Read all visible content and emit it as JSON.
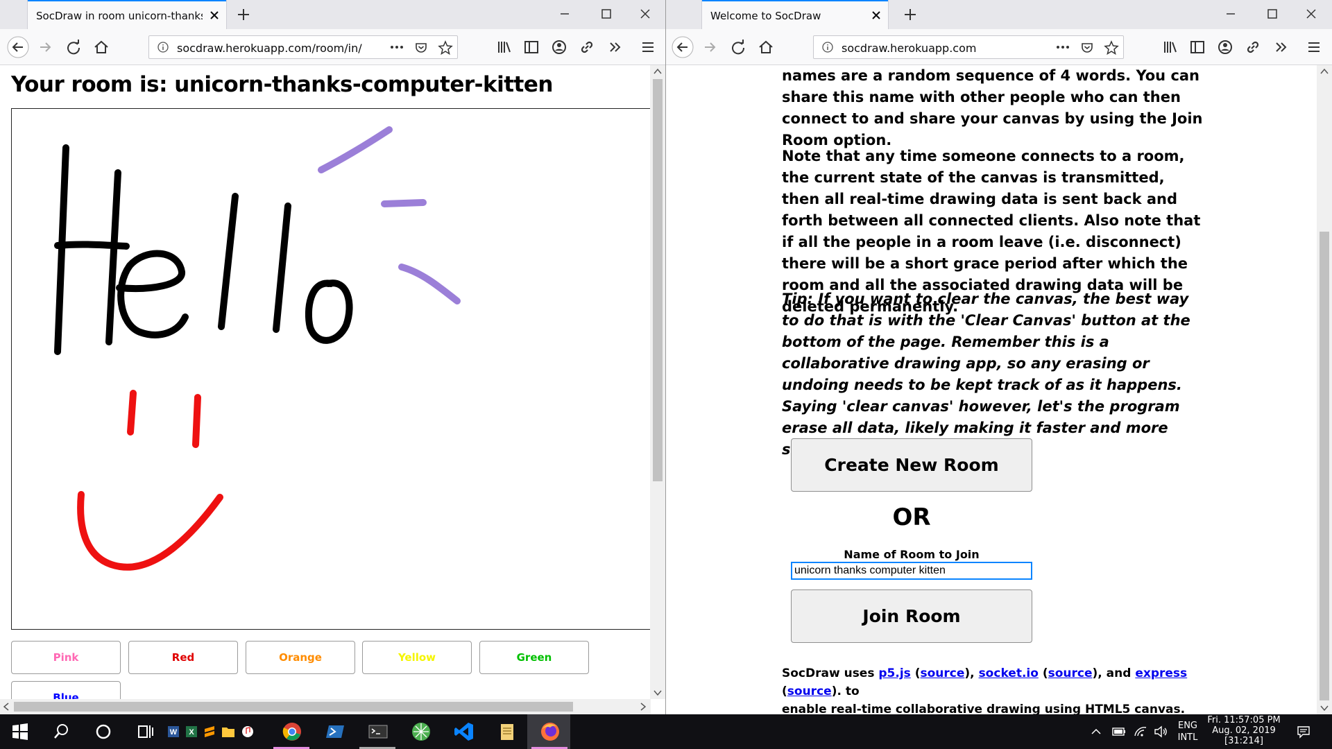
{
  "left_window": {
    "tab_title": "SocDraw in room unicorn-thanks-c",
    "url": "socdraw.herokuapp.com/room/in/",
    "heading": "Your room is: unicorn-thanks-computer-kitten",
    "color_buttons": [
      {
        "label": "Pink",
        "color": "#ff69b4"
      },
      {
        "label": "Red",
        "color": "#e00000"
      },
      {
        "label": "Orange",
        "color": "#ff8c00"
      },
      {
        "label": "Yellow",
        "color": "#f5f500"
      },
      {
        "label": "Green",
        "color": "#00c000"
      },
      {
        "label": "Blue",
        "color": "#0000ff"
      }
    ],
    "stroke_colors": {
      "black": "#000000",
      "purple": "#9b7fd8",
      "red": "#ee1111"
    }
  },
  "right_window": {
    "tab_title": "Welcome to SocDraw",
    "url": "socdraw.herokuapp.com",
    "para1": "names are a random sequence of 4 words. You can share this name with other people who can then connect to and share your canvas by using the Join Room option.",
    "para2": "Note that any time someone connects to a room, the current state of the canvas is transmitted, then all real-time drawing data is sent back and forth between all connected clients. Also note that if all the people in a room leave (i.e. disconnect) there will be a short grace period after which the room and all the associated drawing data will be deleted permanently.",
    "tip": "Tip: If you want to clear the canvas, the best way to do that is with the 'Clear Canvas' button at the bottom of the page. Remember this is a collaborative drawing app, so any erasing or undoing needs to be kept track of as it happens. Saying 'clear canvas' however, let's the program erase all data, likely making it faster and more stable.",
    "create_button": "Create New Room",
    "or_label": "OR",
    "join_label": "Name of Room to Join",
    "join_input_value": "unicorn thanks computer kitten",
    "join_button": "Join Room",
    "footer": {
      "prefix": "SocDraw uses ",
      "p5": "p5.js",
      "socketio": "socket.io",
      "express": "express",
      "source": "source",
      "suffix": "enable real-time collaborative drawing using HTML5 canvas.",
      "to": ". to"
    }
  },
  "taskbar": {
    "lang_line1": "ENG",
    "lang_line2": "INTL",
    "clock_line1": "Fri. 11:57:05 PM",
    "clock_line2": "Aug. 02, 2019",
    "clock_line3": "[31:214]",
    "apps": [
      "windows-start",
      "search",
      "cortana",
      "task-view",
      "word",
      "excel",
      "sublime",
      "file-explorer",
      "itunes",
      "chrome",
      "powershell",
      "terminal",
      "network-app",
      "vscode",
      "notepad",
      "firefox"
    ]
  }
}
